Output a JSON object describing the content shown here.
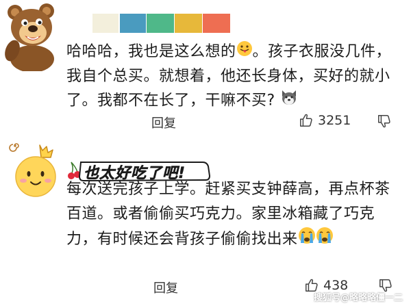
{
  "comments": [
    {
      "body": "哈哈哈，我也是这么想的",
      "body_rest": "。孩子衣服没几件，我自个总买。就想着，他还长身体，买好的就小了。我都不在长了，干嘛不买?",
      "reply_label": "回复",
      "like_count": "3251",
      "emoji_after_body": "tongue-face-icon",
      "emoji_end": "husky-icon",
      "username_colors": [
        "#f3efdc",
        "#4a9bbf",
        "#4fb889",
        "#e7b83a",
        "#ee6e52"
      ]
    },
    {
      "sticker_text": "也太好吃了吧!",
      "body": "每次送完孩子上学。赶紧买支钟薛高，再点杯茶百道。或者偷偷买巧克力。家里冰箱藏了巧克力，有时候还会背孩子偷偷找出来",
      "reply_label": "回复",
      "like_count": "438",
      "emoji_end": "crying-face-icon"
    }
  ],
  "watermark": "搜狐号@略略略僵一二"
}
